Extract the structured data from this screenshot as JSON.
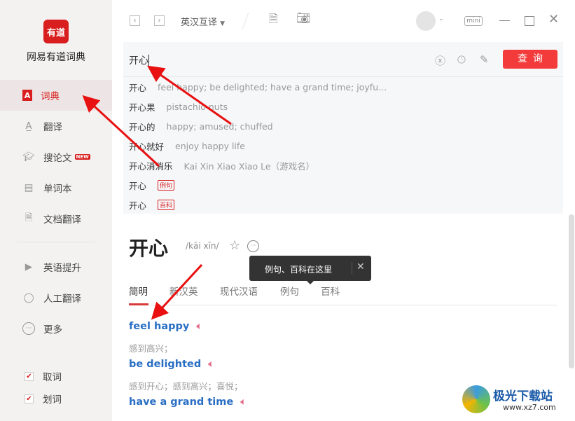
{
  "app": {
    "logo_text": "有道",
    "name": "网易有道词典"
  },
  "sidebar": {
    "items": [
      {
        "label": "词典",
        "icon": "dictionary-icon",
        "active": true
      },
      {
        "label": "翻译",
        "icon": "translate-icon"
      },
      {
        "label": "搜论文",
        "icon": "graduation-cap-icon",
        "badge": "NEW"
      },
      {
        "label": "单词本",
        "icon": "wordbook-icon"
      },
      {
        "label": "文档翻译",
        "icon": "document-icon"
      },
      {
        "label": "英语提升",
        "icon": "play-book-icon"
      },
      {
        "label": "人工翻译",
        "icon": "human-translate-icon"
      },
      {
        "label": "更多",
        "icon": "more-icon"
      }
    ],
    "checks": [
      {
        "label": "取词",
        "checked": true
      },
      {
        "label": "划词",
        "checked": true
      }
    ]
  },
  "topbar": {
    "mode": "英汉互译",
    "mini": "mini"
  },
  "search": {
    "value": "开心",
    "button": "查询",
    "suggestions": [
      {
        "word": "开心",
        "desc": "feel happy; be delighted; have a grand time; joyfu..."
      },
      {
        "word": "开心果",
        "desc": "pistachio nuts"
      },
      {
        "word": "开心的",
        "desc": "happy; amused; chuffed"
      },
      {
        "word": "开心就好",
        "desc": "enjoy happy life"
      },
      {
        "word": "开心消消乐",
        "desc": "Kai Xin Xiao Xiao Le（游戏名）"
      },
      {
        "word": "开心",
        "tag": "例句"
      },
      {
        "word": "开心",
        "tag": "百科"
      }
    ]
  },
  "entry": {
    "headword": "开心",
    "pinyin": "/kāi xīn/",
    "tooltip": "例句、百科在这里",
    "tabs": [
      "简明",
      "新汉英",
      "现代汉语",
      "例句",
      "百科"
    ],
    "definitions": [
      {
        "en": "feel happy",
        "zh": "感到高兴；"
      },
      {
        "en": "be delighted",
        "zh": "感到开心；感到高兴；喜悦；"
      },
      {
        "en": "have a grand time",
        "zh": ""
      }
    ]
  },
  "watermark": {
    "text": "极光下载站",
    "url": "www.xz7.com"
  },
  "colors": {
    "accent": "#d81e1e",
    "link": "#2a6fc4",
    "query_button": "#f33b3b"
  }
}
